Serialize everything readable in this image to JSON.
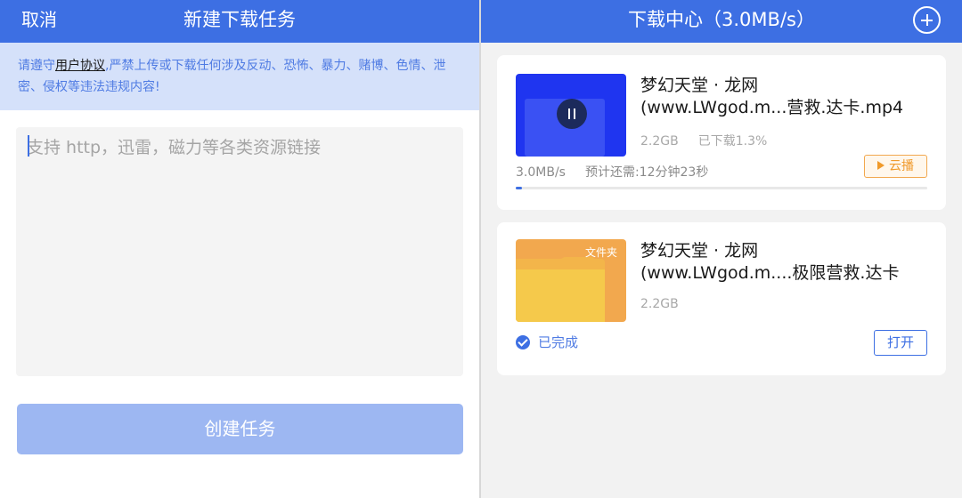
{
  "left_panel": {
    "header": {
      "cancel_label": "取消",
      "title": "新建下载任务"
    },
    "notice": {
      "prefix": "请遵守",
      "link_text": "用户协议",
      "suffix": ",严禁上传或下载任何涉及反动、恐怖、暴力、赌博、色情、泄密、侵权等违法违规内容!"
    },
    "link_input": {
      "placeholder": "支持 http，迅雷，磁力等各类资源链接",
      "value": ""
    },
    "create_button_label": "创建任务"
  },
  "right_panel": {
    "header": {
      "title": "下载中心（3.0MB/s）",
      "add_icon": "plus-circle-icon"
    },
    "tasks": [
      {
        "name": "梦幻天堂 · 龙网\n(www.LWgod.m...营救.达卡.mp4",
        "thumbnail": "video-thumbnail",
        "size": "2.2GB",
        "progress_text": "已下载1.3%",
        "progress": 0.013,
        "speed": "3.0MB/s",
        "eta": "预计还需:12分钟23秒",
        "action_label": "云播",
        "state_icon": "pause-icon"
      },
      {
        "name": "梦幻天堂 · 龙网\n(www.LWgod.m....极限营救.达卡",
        "thumbnail": "folder-thumbnail",
        "folder_label": "文件夹",
        "size": "2.2GB",
        "status": "已完成",
        "status_icon": "check-circle-icon",
        "action_label": "打开"
      }
    ]
  },
  "colors": {
    "header_blue": "#3d6fe3",
    "notice_bg": "#d5e1fa",
    "create_button_disabled": "#9db7f2",
    "cloud_play_orange": "#f09a2b",
    "folder_yellow": "#f5c94b"
  }
}
